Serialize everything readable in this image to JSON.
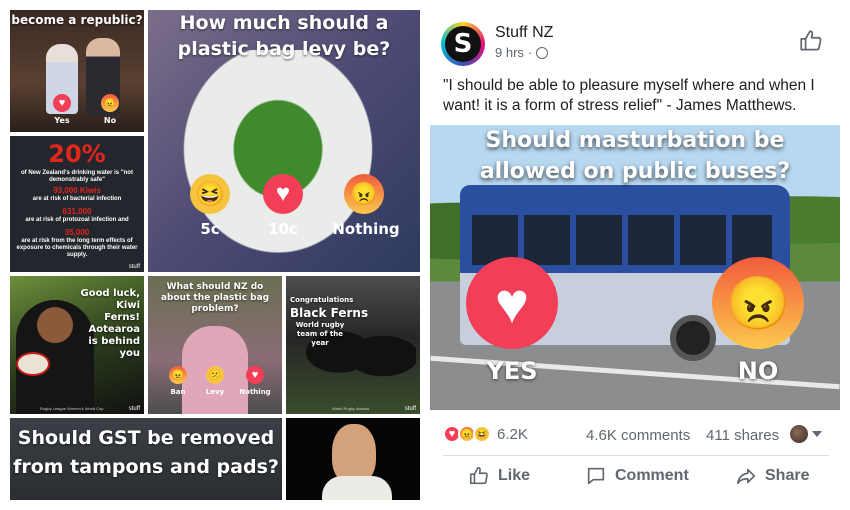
{
  "collage": {
    "republic": {
      "title": "become a republic?",
      "yes": "Yes",
      "no": "No"
    },
    "bag_levy": {
      "title": "How much should a plastic bag levy be?",
      "options": [
        "5c",
        "10c",
        "Nothing"
      ]
    },
    "water": {
      "big": "20%",
      "line1": "of New Zealand's drinking water is \"not demonstrably safe\"",
      "num2": "93,000 Kiwis",
      "line2": "are at risk of bacterial infection",
      "num3": "631,000",
      "line3": "are at risk of protozoal infection and",
      "num4": "35,000",
      "line4": "are at risk from the long term effects of exposure to chemicals through their water supply.",
      "brand": "stuff"
    },
    "kiwi_ferns": {
      "text": "Good luck, Kiwi Ferns! Aotearoa is behind you",
      "caption": "Rugby League Women's World Cup",
      "brand": "stuff"
    },
    "plastic_ban": {
      "title": "What should NZ do about the plastic bag problem?",
      "options": [
        "Ban",
        "Levy",
        "Nothing"
      ]
    },
    "black_ferns": {
      "line1": "Congratulations",
      "line2": "Black Ferns",
      "line3": "World rugby team of the year",
      "caption": "World Rugby Awards",
      "brand": "stuff"
    },
    "gst": {
      "title": "Should GST be removed from tampons and pads?"
    }
  },
  "post": {
    "page_name": "Stuff NZ",
    "time": "9 hrs",
    "dot": "·",
    "text": "\"I should be able to pleasure myself where and when I want! it is a form of stress relief\" - James Matthews.",
    "image_title": "Should masturbation be allowed on public buses?",
    "yes": "YES",
    "no": "NO",
    "reaction_count": "6.2K",
    "comments": "4.6K comments",
    "shares": "411 shares",
    "actions": {
      "like": "Like",
      "comment": "Comment",
      "share": "Share"
    }
  },
  "colors": {
    "fb_blue": "#4267b2",
    "love": "#f33e58",
    "angry": "#f25b3c",
    "water_red": "#e1261c"
  }
}
